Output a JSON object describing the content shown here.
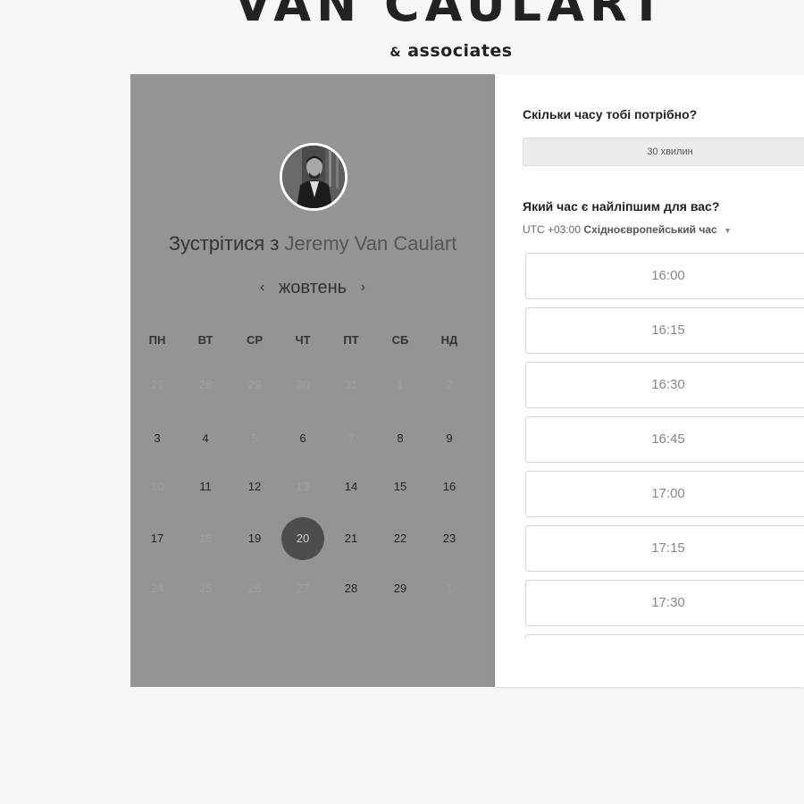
{
  "brand": {
    "title": "VAN CAULART",
    "amp": "&",
    "subtitle": "associates"
  },
  "left": {
    "meet_prefix": "Зустрітися з",
    "host_name": "Jeremy Van Caulart",
    "month": "жовтень",
    "prev_symbol": "‹",
    "next_symbol": "›",
    "weekdays": [
      "ПН",
      "ВТ",
      "СР",
      "ЧТ",
      "ПТ",
      "СБ",
      "НД"
    ],
    "weeks": [
      [
        {
          "d": "27",
          "s": "muted"
        },
        {
          "d": "28",
          "s": "muted"
        },
        {
          "d": "29",
          "s": "muted"
        },
        {
          "d": "30",
          "s": "muted"
        },
        {
          "d": "31",
          "s": "muted"
        },
        {
          "d": "1",
          "s": "muted"
        },
        {
          "d": "2",
          "s": "muted"
        }
      ],
      [
        {
          "d": "3",
          "s": "on"
        },
        {
          "d": "4",
          "s": "on"
        },
        {
          "d": "5",
          "s": "muted"
        },
        {
          "d": "6",
          "s": "on"
        },
        {
          "d": "7",
          "s": "muted"
        },
        {
          "d": "8",
          "s": "on"
        },
        {
          "d": "9",
          "s": "on"
        }
      ],
      [
        {
          "d": "10",
          "s": "muted"
        },
        {
          "d": "11",
          "s": "on"
        },
        {
          "d": "12",
          "s": "on"
        },
        {
          "d": "13",
          "s": "muted"
        },
        {
          "d": "14",
          "s": "on"
        },
        {
          "d": "15",
          "s": "on"
        },
        {
          "d": "16",
          "s": "on"
        }
      ],
      [
        {
          "d": "17",
          "s": "on"
        },
        {
          "d": "18",
          "s": "muted"
        },
        {
          "d": "19",
          "s": "on"
        },
        {
          "d": "20",
          "s": "selected"
        },
        {
          "d": "21",
          "s": "on"
        },
        {
          "d": "22",
          "s": "on"
        },
        {
          "d": "23",
          "s": "on"
        }
      ],
      [
        {
          "d": "24",
          "s": "muted"
        },
        {
          "d": "25",
          "s": "muted"
        },
        {
          "d": "26",
          "s": "muted"
        },
        {
          "d": "27",
          "s": "muted"
        },
        {
          "d": "28",
          "s": "on"
        },
        {
          "d": "29",
          "s": "on"
        },
        {
          "d": "1",
          "s": "muted"
        }
      ]
    ],
    "selected_day": "20"
  },
  "right": {
    "duration_question": "Скільки часу тобі потрібно?",
    "duration_value": "30 хвилин",
    "time_question": "Який час є найліпшим для вас?",
    "tz_offset": "UTC +03:00",
    "tz_name": "Східноєвропейський час",
    "slots": [
      "16:00",
      "16:15",
      "16:30",
      "16:45",
      "17:00",
      "17:15",
      "17:30",
      ""
    ]
  },
  "colors": {
    "left_panel": "#949494",
    "selected_day": "#4d4d4d",
    "page_bg": "#f7f7f7"
  },
  "icons": [
    "profile-photo",
    "chevron-left-icon",
    "chevron-right-icon",
    "caret-down-icon"
  ]
}
